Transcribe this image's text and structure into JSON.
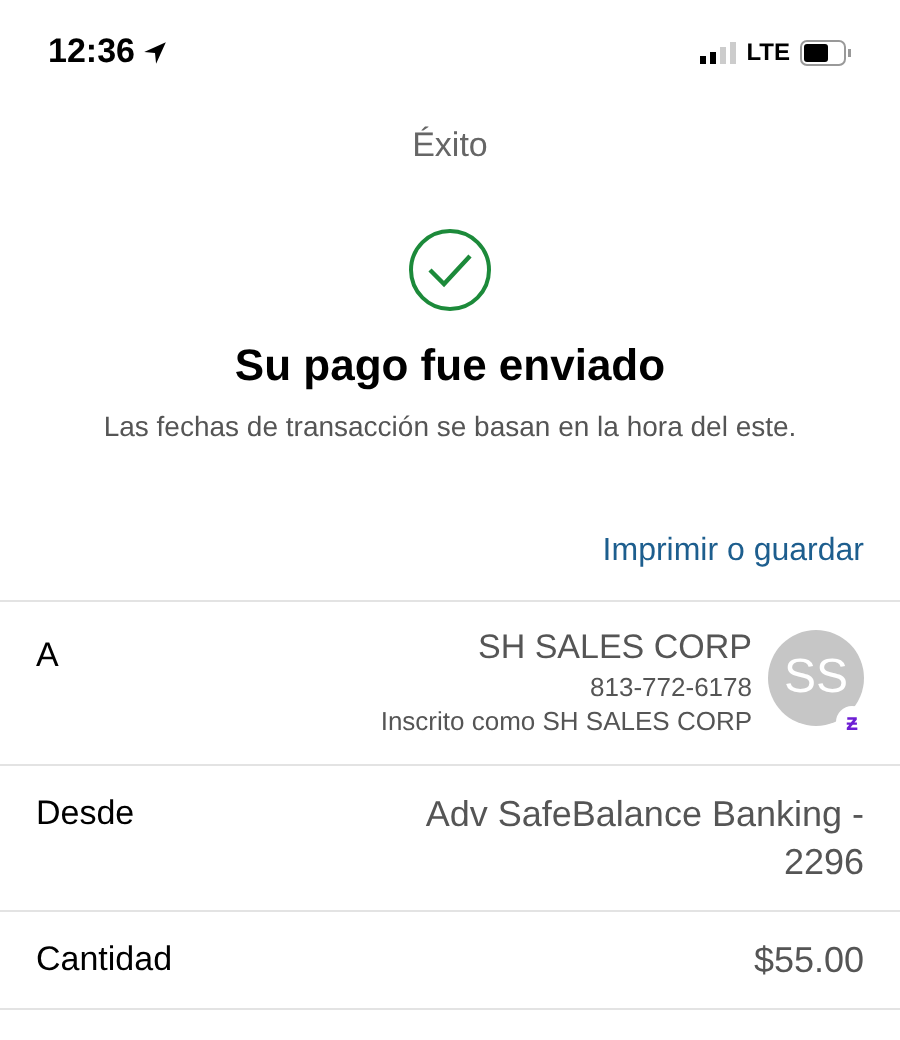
{
  "status_bar": {
    "time": "12:36",
    "network": "LTE"
  },
  "nav": {
    "title": "Éxito"
  },
  "confirmation": {
    "heading": "Su pago fue enviado",
    "note": "Las fechas de transacción se basan en la hora del este."
  },
  "print_link": "Imprimir o guardar",
  "details": [
    {
      "kind": "recipient",
      "label": "A",
      "value": "SH SALES CORP",
      "phone": "813-772-6178",
      "enrolled": "Inscrito como SH SALES CORP",
      "avatar": "SS",
      "badge": "ƶ"
    },
    {
      "kind": "text",
      "label": "Desde",
      "value": "Adv SafeBalance Banking - 2296"
    },
    {
      "kind": "text",
      "label": "Cantidad",
      "value": "$55.00"
    }
  ]
}
